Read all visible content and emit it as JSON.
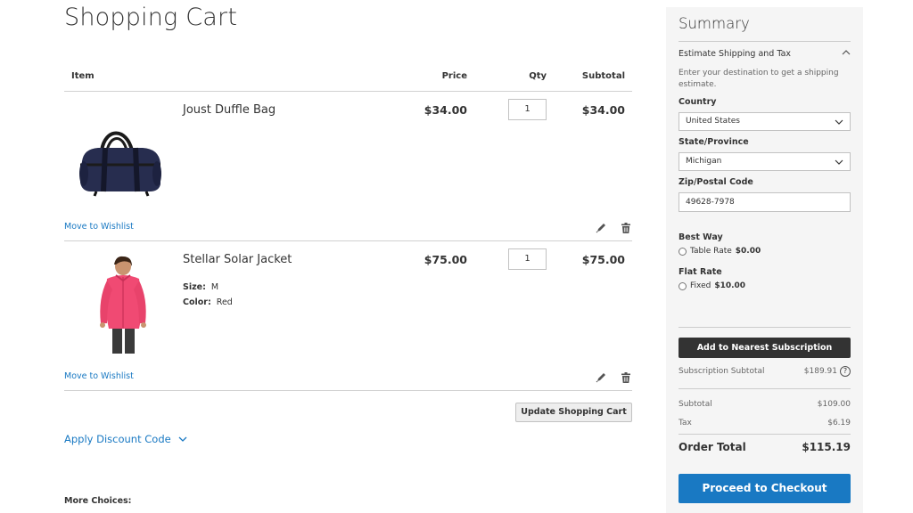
{
  "page": {
    "title": "Shopping Cart"
  },
  "cart": {
    "headers": {
      "item": "Item",
      "price": "Price",
      "qty": "Qty",
      "subtotal": "Subtotal"
    },
    "items": [
      {
        "name": "Joust Duffle Bag",
        "price": "$34.00",
        "qty": "1",
        "subtotal": "$34.00",
        "wishlist": "Move to Wishlist"
      },
      {
        "name": "Stellar Solar Jacket",
        "price": "$75.00",
        "qty": "1",
        "subtotal": "$75.00",
        "options": [
          {
            "label": "Size:",
            "value": "M"
          },
          {
            "label": "Color:",
            "value": "Red"
          }
        ],
        "wishlist": "Move to Wishlist"
      }
    ],
    "update_label": "Update Shopping Cart",
    "discount_label": "Apply Discount Code",
    "more_choices": "More Choices:"
  },
  "summary": {
    "title": "Summary",
    "estimate_title": "Estimate Shipping and Tax",
    "estimate_desc": "Enter your destination to get a shipping estimate.",
    "country_label": "Country",
    "country_value": "United States",
    "state_label": "State/Province",
    "state_value": "Michigan",
    "zip_label": "Zip/Postal Code",
    "zip_value": "49628-7978",
    "methods": [
      {
        "title": "Best Way",
        "option": "Table Rate",
        "amount": "$0.00"
      },
      {
        "title": "Flat Rate",
        "option": "Fixed",
        "amount": "$10.00"
      }
    ],
    "subscription_button": "Add to Nearest Subscription",
    "subscription_subtotal_label": "Subscription Subtotal",
    "subscription_subtotal_value": "$189.91",
    "subtotal_label": "Subtotal",
    "subtotal_value": "$109.00",
    "tax_label": "Tax",
    "tax_value": "$6.19",
    "order_total_label": "Order Total",
    "order_total_value": "$115.19",
    "checkout_label": "Proceed to Checkout",
    "help_glyph": "?"
  },
  "colors": {
    "link": "#1979c3",
    "primary_button": "#1979c3",
    "dark_button": "#333333",
    "sidebar_bg": "#f5f5f5"
  },
  "icons": [
    "bag-product-image",
    "jacket-product-image",
    "edit-pencil-icon",
    "trash-icon",
    "chevron-down-icon",
    "chevron-up-icon",
    "help-icon"
  ]
}
